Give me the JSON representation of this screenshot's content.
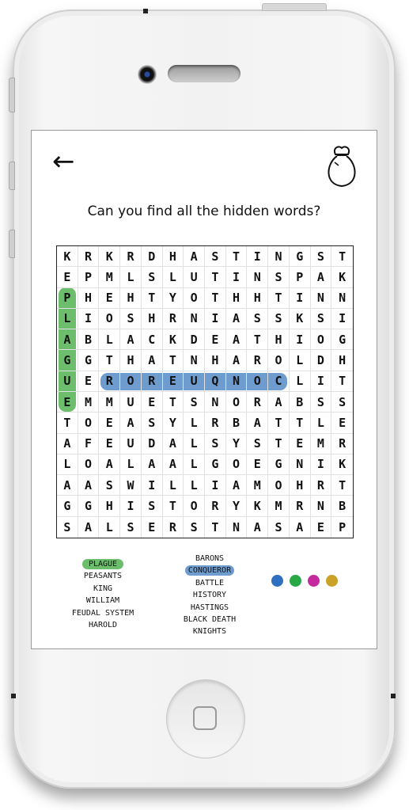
{
  "screen": {
    "title": "Can you find all the hidden words?"
  },
  "grid": [
    [
      "K",
      "R",
      "K",
      "R",
      "D",
      "H",
      "A",
      "S",
      "T",
      "I",
      "N",
      "G",
      "S",
      "T"
    ],
    [
      "E",
      "P",
      "M",
      "L",
      "S",
      "L",
      "U",
      "T",
      "I",
      "N",
      "S",
      "P",
      "A",
      "K"
    ],
    [
      "P",
      "H",
      "E",
      "H",
      "T",
      "Y",
      "O",
      "T",
      "H",
      "H",
      "T",
      "I",
      "N",
      "N"
    ],
    [
      "L",
      "I",
      "O",
      "S",
      "H",
      "R",
      "N",
      "I",
      "A",
      "S",
      "S",
      "K",
      "S",
      "I"
    ],
    [
      "A",
      "B",
      "L",
      "A",
      "C",
      "K",
      "D",
      "E",
      "A",
      "T",
      "H",
      "I",
      "O",
      "G"
    ],
    [
      "G",
      "G",
      "T",
      "H",
      "A",
      "T",
      "N",
      "H",
      "A",
      "R",
      "O",
      "L",
      "D",
      "H"
    ],
    [
      "U",
      "E",
      "R",
      "O",
      "R",
      "E",
      "U",
      "Q",
      "N",
      "O",
      "C",
      "L",
      "I",
      "T"
    ],
    [
      "E",
      "M",
      "M",
      "U",
      "E",
      "T",
      "S",
      "N",
      "O",
      "R",
      "A",
      "B",
      "S",
      "S"
    ],
    [
      "T",
      "O",
      "E",
      "A",
      "S",
      "Y",
      "L",
      "R",
      "B",
      "A",
      "T",
      "T",
      "L",
      "E"
    ],
    [
      "A",
      "F",
      "E",
      "U",
      "D",
      "A",
      "L",
      "S",
      "Y",
      "S",
      "T",
      "E",
      "M",
      "R"
    ],
    [
      "L",
      "O",
      "A",
      "L",
      "A",
      "A",
      "L",
      "G",
      "O",
      "E",
      "G",
      "N",
      "I",
      "K"
    ],
    [
      "A",
      "A",
      "S",
      "W",
      "I",
      "L",
      "L",
      "I",
      "A",
      "M",
      "O",
      "H",
      "R",
      "T"
    ],
    [
      "G",
      "G",
      "H",
      "I",
      "S",
      "T",
      "O",
      "R",
      "Y",
      "K",
      "M",
      "R",
      "N",
      "B"
    ],
    [
      "S",
      "A",
      "L",
      "S",
      "E",
      "R",
      "S",
      "T",
      "N",
      "A",
      "S",
      "A",
      "E",
      "P"
    ]
  ],
  "word_list_1": [
    "PLAGUE",
    "PEASANTS",
    "KING",
    "WILLIAM",
    "FEUDAL SYSTEM",
    "HAROLD"
  ],
  "word_list_2": [
    "BARONS",
    "CONQUEROR",
    "BATTLE",
    "HISTORY",
    "HASTINGS",
    "BLACK DEATH",
    "KNIGHTS"
  ],
  "found_words": [
    "PLAGUE",
    "CONQUEROR"
  ],
  "colors": {
    "found_green": "#6cbe6c",
    "found_blue": "#6f9ccf",
    "palette": [
      "#2f6fc1",
      "#28a745",
      "#c42a9b",
      "#c9a227"
    ]
  },
  "icons": {
    "back": "back-arrow-icon",
    "bag": "bag-icon"
  }
}
